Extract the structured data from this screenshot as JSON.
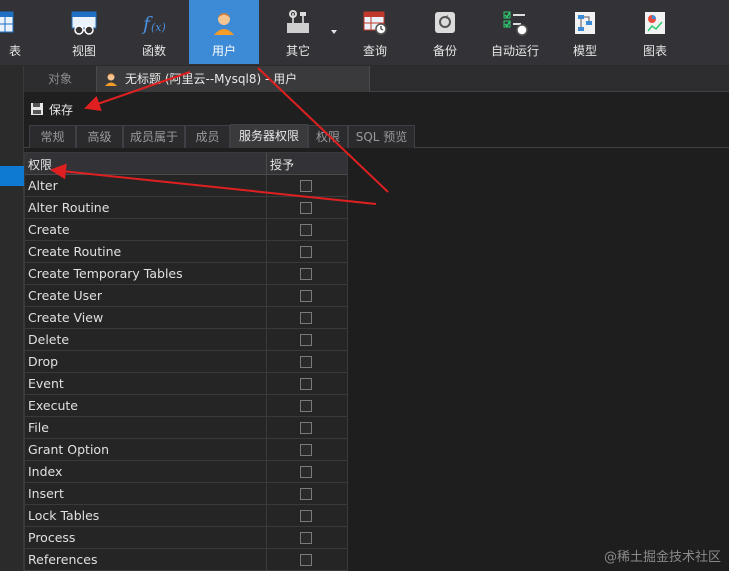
{
  "toolbar": {
    "items": [
      {
        "label": "表",
        "icon": "table-icon"
      },
      {
        "label": "视图",
        "icon": "view-icon"
      },
      {
        "label": "函数",
        "icon": "function-icon"
      },
      {
        "label": "用户",
        "icon": "user-icon",
        "active": true
      },
      {
        "label": "其它",
        "icon": "tools-icon"
      },
      {
        "label": "查询",
        "icon": "query-icon"
      },
      {
        "label": "备份",
        "icon": "backup-icon"
      },
      {
        "label": "自动运行",
        "icon": "automation-icon"
      },
      {
        "label": "模型",
        "icon": "model-icon"
      },
      {
        "label": "图表",
        "icon": "chart-icon"
      }
    ]
  },
  "doc_tabs": {
    "objects_label": "对象",
    "active_label": "无标题 (阿里云--Mysql8) - 用户"
  },
  "save": {
    "label": "保存"
  },
  "sub_tabs": [
    "常规",
    "高级",
    "成员属于",
    "成员",
    "服务器权限",
    "权限",
    "SQL 预览"
  ],
  "grid": {
    "columns": [
      "权限",
      "授予"
    ],
    "rows": [
      "Alter",
      "Alter Routine",
      "Create",
      "Create Routine",
      "Create Temporary Tables",
      "Create User",
      "Create View",
      "Delete",
      "Drop",
      "Event",
      "Execute",
      "File",
      "Grant Option",
      "Index",
      "Insert",
      "Lock Tables",
      "Process",
      "References"
    ]
  },
  "watermark": "@稀土掘金技术社区",
  "colors": {
    "toolbar_bg": "#333337",
    "active_blue": "#3d8bd6",
    "annotation_red": "#e02020",
    "background": "#1e1e1e"
  }
}
